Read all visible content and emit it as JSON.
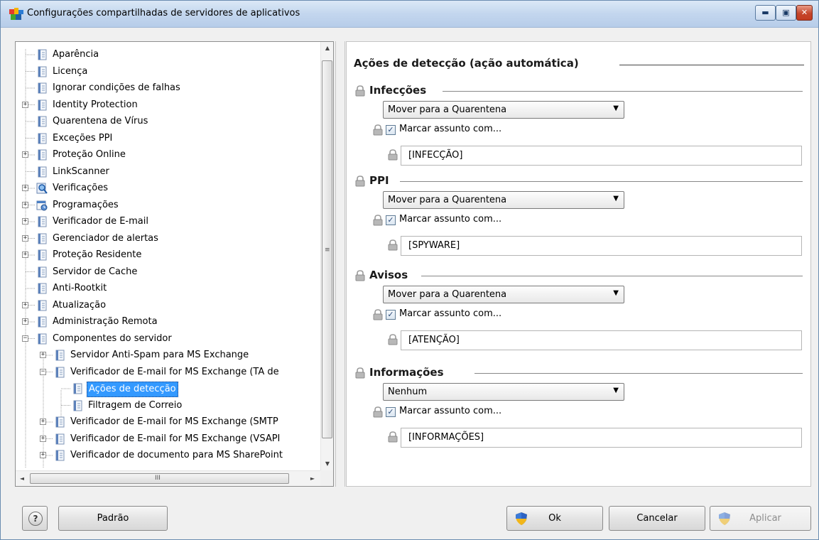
{
  "window": {
    "title": "Configurações compartilhadas de servidores de aplicativos"
  },
  "titlebar_buttons": {
    "minimize": "▬",
    "maximize": "▣",
    "close": "✕"
  },
  "tree": {
    "items": [
      {
        "label": "Aparência",
        "level": 0,
        "expandable": false,
        "icon": "page-icon"
      },
      {
        "label": "Licença",
        "level": 0,
        "expandable": false,
        "icon": "page-icon"
      },
      {
        "label": "Ignorar condições de falhas",
        "level": 0,
        "expandable": false,
        "icon": "page-icon"
      },
      {
        "label": "Identity Protection",
        "level": 0,
        "expandable": true,
        "icon": "page-icon"
      },
      {
        "label": "Quarentena de Vírus",
        "level": 0,
        "expandable": false,
        "icon": "page-icon"
      },
      {
        "label": "Exceções PPI",
        "level": 0,
        "expandable": false,
        "icon": "page-icon"
      },
      {
        "label": "Proteção Online",
        "level": 0,
        "expandable": true,
        "icon": "page-icon"
      },
      {
        "label": "LinkScanner",
        "level": 0,
        "expandable": false,
        "icon": "page-icon"
      },
      {
        "label": "Verificações",
        "level": 0,
        "expandable": true,
        "icon": "magnifier-icon"
      },
      {
        "label": "Programações",
        "level": 0,
        "expandable": true,
        "icon": "schedule-icon"
      },
      {
        "label": "Verificador de E-mail",
        "level": 0,
        "expandable": true,
        "icon": "page-icon"
      },
      {
        "label": "Gerenciador de alertas",
        "level": 0,
        "expandable": true,
        "icon": "page-icon"
      },
      {
        "label": "Proteção Residente",
        "level": 0,
        "expandable": true,
        "icon": "page-icon"
      },
      {
        "label": "Servidor de Cache",
        "level": 0,
        "expandable": false,
        "icon": "page-icon"
      },
      {
        "label": "Anti-Rootkit",
        "level": 0,
        "expandable": false,
        "icon": "page-icon"
      },
      {
        "label": "Atualização",
        "level": 0,
        "expandable": true,
        "icon": "page-icon"
      },
      {
        "label": "Administração Remota",
        "level": 0,
        "expandable": true,
        "icon": "page-icon"
      },
      {
        "label": "Componentes do servidor",
        "level": 0,
        "expandable": true,
        "expanded": true,
        "icon": "page-icon"
      },
      {
        "label": "Servidor Anti-Spam para MS Exchange",
        "level": 1,
        "expandable": true,
        "icon": "page-icon"
      },
      {
        "label": "Verificador de E-mail for MS Exchange (TA de",
        "level": 1,
        "expandable": true,
        "expanded": true,
        "icon": "page-icon"
      },
      {
        "label": "Ações de detecção",
        "level": 2,
        "expandable": false,
        "selected": true,
        "icon": "page-icon"
      },
      {
        "label": "Filtragem de Correio",
        "level": 2,
        "expandable": false,
        "icon": "page-icon"
      },
      {
        "label": "Verificador de E-mail for MS Exchange (SMTP",
        "level": 1,
        "expandable": true,
        "icon": "page-icon"
      },
      {
        "label": "Verificador de E-mail for MS Exchange (VSAPI",
        "level": 1,
        "expandable": true,
        "icon": "page-icon"
      },
      {
        "label": "Verificador de documento para MS SharePoint",
        "level": 1,
        "expandable": true,
        "icon": "page-icon"
      }
    ]
  },
  "scrollbar": {
    "up": "▲",
    "down": "▼",
    "left": "◄",
    "right": "►",
    "vgrip": "≡",
    "hgrip": "III"
  },
  "main": {
    "title": "Ações de detecção (ação automática)",
    "sections": [
      {
        "title": "Infecções",
        "action": "Mover para a Quarentena",
        "checkbox_label": "Marcar assunto com...",
        "checked": true,
        "tag": "[INFECÇÃO]"
      },
      {
        "title": "PPI",
        "action": "Mover para a Quarentena",
        "checkbox_label": "Marcar assunto com...",
        "checked": true,
        "tag": "[SPYWARE]"
      },
      {
        "title": "Avisos",
        "action": "Mover para a Quarentena",
        "checkbox_label": "Marcar assunto com...",
        "checked": true,
        "tag": "[ATENÇÃO]"
      },
      {
        "title": "Informações",
        "action": "Nenhum",
        "checkbox_label": "Marcar assunto com...",
        "checked": true,
        "tag": "[INFORMAÇÕES]"
      }
    ]
  },
  "buttons": {
    "help": "?",
    "default": "Padrão",
    "ok": "Ok",
    "cancel": "Cancelar",
    "apply": "Aplicar"
  },
  "colors": {
    "selection": "#3399ff",
    "title_gradient_top": "#dbe8f6",
    "close_red": "#c4452b"
  }
}
